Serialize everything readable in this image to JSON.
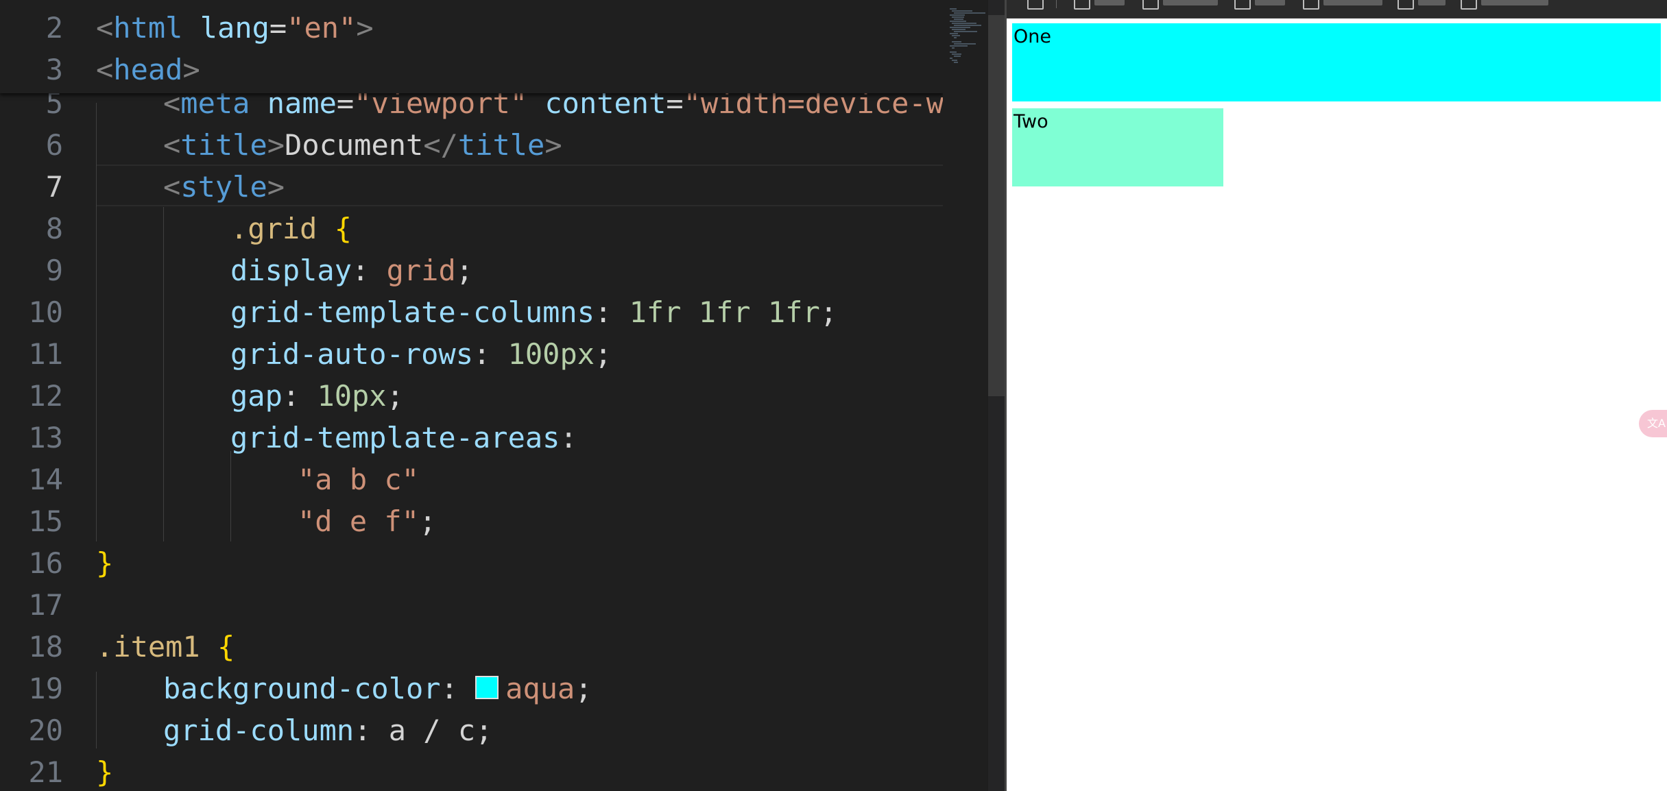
{
  "editor": {
    "sticky_lines": [
      {
        "num": "2",
        "tokens": [
          {
            "t": "<",
            "c": "br"
          },
          {
            "t": "html",
            "c": "tag"
          },
          {
            "t": " ",
            "c": "pun"
          },
          {
            "t": "lang",
            "c": "attr"
          },
          {
            "t": "=",
            "c": "pun"
          },
          {
            "t": "\"en\"",
            "c": "str"
          },
          {
            "t": ">",
            "c": "br"
          }
        ]
      },
      {
        "num": "3",
        "tokens": [
          {
            "t": "<",
            "c": "br"
          },
          {
            "t": "head",
            "c": "tag"
          },
          {
            "t": ">",
            "c": "br"
          }
        ]
      }
    ],
    "lines": [
      {
        "num": "5",
        "indent": 1,
        "tokens": [
          {
            "t": "<",
            "c": "br"
          },
          {
            "t": "meta",
            "c": "tag"
          },
          {
            "t": " ",
            "c": "pun"
          },
          {
            "t": "name",
            "c": "attr"
          },
          {
            "t": "=",
            "c": "pun"
          },
          {
            "t": "\"viewport\"",
            "c": "str"
          },
          {
            "t": " ",
            "c": "pun"
          },
          {
            "t": "content",
            "c": "attr"
          },
          {
            "t": "=",
            "c": "pun"
          },
          {
            "t": "\"width=device-wi",
            "c": "str"
          }
        ]
      },
      {
        "num": "6",
        "indent": 1,
        "tokens": [
          {
            "t": "<",
            "c": "br"
          },
          {
            "t": "title",
            "c": "tag"
          },
          {
            "t": ">",
            "c": "br"
          },
          {
            "t": "Document",
            "c": "pun"
          },
          {
            "t": "</",
            "c": "br"
          },
          {
            "t": "title",
            "c": "tag"
          },
          {
            "t": ">",
            "c": "br"
          }
        ]
      },
      {
        "num": "7",
        "indent": 1,
        "active": true,
        "tokens": [
          {
            "t": "<",
            "c": "br"
          },
          {
            "t": "style",
            "c": "tag"
          },
          {
            "t": ">",
            "c": "br"
          }
        ]
      },
      {
        "num": "8",
        "indent": 2,
        "tokens": [
          {
            "t": ".grid",
            "c": "sel"
          },
          {
            "t": " ",
            "c": "pun"
          },
          {
            "t": "{",
            "c": "brace"
          }
        ]
      },
      {
        "num": "9",
        "indent": 2,
        "tokens": [
          {
            "t": "display",
            "c": "prop"
          },
          {
            "t": ": ",
            "c": "pun"
          },
          {
            "t": "grid",
            "c": "str"
          },
          {
            "t": ";",
            "c": "pun"
          }
        ]
      },
      {
        "num": "10",
        "indent": 2,
        "tokens": [
          {
            "t": "grid-template-columns",
            "c": "prop"
          },
          {
            "t": ": ",
            "c": "pun"
          },
          {
            "t": "1fr 1fr 1fr",
            "c": "num"
          },
          {
            "t": ";",
            "c": "pun"
          }
        ]
      },
      {
        "num": "11",
        "indent": 2,
        "tokens": [
          {
            "t": "grid-auto-rows",
            "c": "prop"
          },
          {
            "t": ": ",
            "c": "pun"
          },
          {
            "t": "100px",
            "c": "num"
          },
          {
            "t": ";",
            "c": "pun"
          }
        ]
      },
      {
        "num": "12",
        "indent": 2,
        "tokens": [
          {
            "t": "gap",
            "c": "prop"
          },
          {
            "t": ": ",
            "c": "pun"
          },
          {
            "t": "10px",
            "c": "num"
          },
          {
            "t": ";",
            "c": "pun"
          }
        ]
      },
      {
        "num": "13",
        "indent": 2,
        "tokens": [
          {
            "t": "grid-template-areas",
            "c": "prop"
          },
          {
            "t": ":",
            "c": "pun"
          }
        ]
      },
      {
        "num": "14",
        "indent": 3,
        "tokens": [
          {
            "t": "\"a b c\"",
            "c": "str"
          }
        ]
      },
      {
        "num": "15",
        "indent": 3,
        "tokens": [
          {
            "t": "\"d e f\"",
            "c": "str"
          },
          {
            "t": ";",
            "c": "pun"
          }
        ]
      },
      {
        "num": "16",
        "indent": 0,
        "tokens": [
          {
            "t": "}",
            "c": "brace"
          }
        ]
      },
      {
        "num": "17",
        "indent": 0,
        "tokens": []
      },
      {
        "num": "18",
        "indent": 0,
        "tokens": [
          {
            "t": ".item1",
            "c": "sel"
          },
          {
            "t": " ",
            "c": "pun"
          },
          {
            "t": "{",
            "c": "brace"
          }
        ]
      },
      {
        "num": "19",
        "indent": 1,
        "tokens": [
          {
            "t": "background-color",
            "c": "prop"
          },
          {
            "t": ": ",
            "c": "pun"
          },
          {
            "t": "",
            "c": "swatch"
          },
          {
            "t": "aqua",
            "c": "str"
          },
          {
            "t": ";",
            "c": "pun"
          }
        ]
      },
      {
        "num": "20",
        "indent": 1,
        "tokens": [
          {
            "t": "grid-column",
            "c": "prop"
          },
          {
            "t": ": ",
            "c": "pun"
          },
          {
            "t": "a / c",
            "c": "pun"
          },
          {
            "t": ";",
            "c": "pun"
          }
        ]
      },
      {
        "num": "21",
        "indent": 0,
        "tokens": [
          {
            "t": "}",
            "c": "brace"
          }
        ]
      }
    ],
    "swatch_color": "#00ffff"
  },
  "preview": {
    "bookmark_count": 7,
    "items": [
      {
        "label": "One",
        "color": "#00ffff"
      },
      {
        "label": "Two",
        "color": "#7fffd4"
      }
    ],
    "translate_icon": "translate-icon"
  }
}
